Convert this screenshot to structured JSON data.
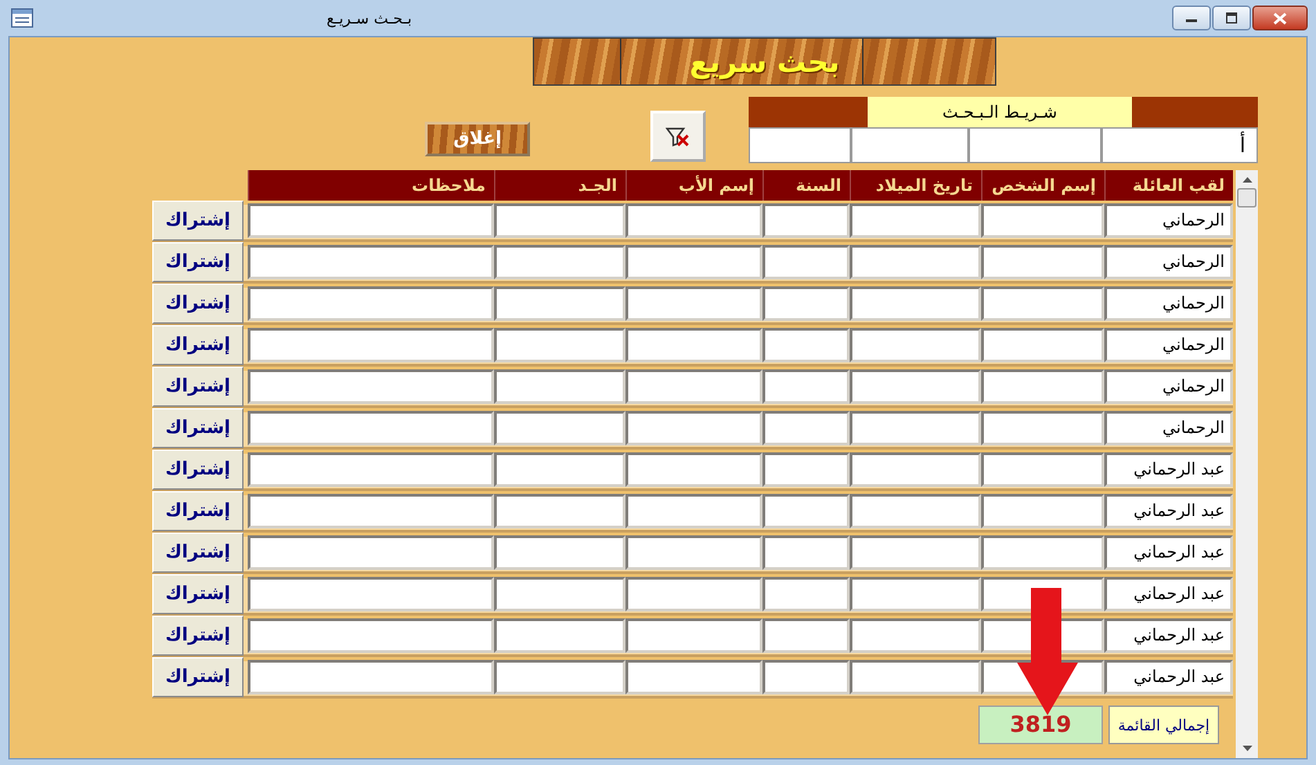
{
  "window": {
    "title": "بـحـث سـريـع"
  },
  "banner": {
    "title": "بحث سريع"
  },
  "close_button": {
    "label": "إغلاق"
  },
  "search": {
    "label": "شـريـط الـبـحـث",
    "value": "أ"
  },
  "table": {
    "columns": [
      "لقب العائلة",
      "إسم الشخص",
      "تاريخ الميلاد",
      "السنة",
      "إسم الأب",
      "الجـد",
      "ملاحظات"
    ],
    "rows": [
      {
        "family": "الرحماني",
        "action": "إشتراك"
      },
      {
        "family": "الرحماني",
        "action": "إشتراك"
      },
      {
        "family": "الرحماني",
        "action": "إشتراك"
      },
      {
        "family": "الرحماني",
        "action": "إشتراك"
      },
      {
        "family": "الرحماني",
        "action": "إشتراك"
      },
      {
        "family": "الرحماني",
        "action": "إشتراك"
      },
      {
        "family": "عبد الرحماني",
        "action": "إشتراك"
      },
      {
        "family": "عبد الرحماني",
        "action": "إشتراك"
      },
      {
        "family": "عبد الرحماني",
        "action": "إشتراك"
      },
      {
        "family": "عبد الرحماني",
        "action": "إشتراك"
      },
      {
        "family": "عبد الرحماني",
        "action": "إشتراك"
      },
      {
        "family": "عبد الرحماني",
        "action": "إشتراك"
      }
    ]
  },
  "total": {
    "label": "إجمالي القائمة",
    "value": "3819"
  }
}
